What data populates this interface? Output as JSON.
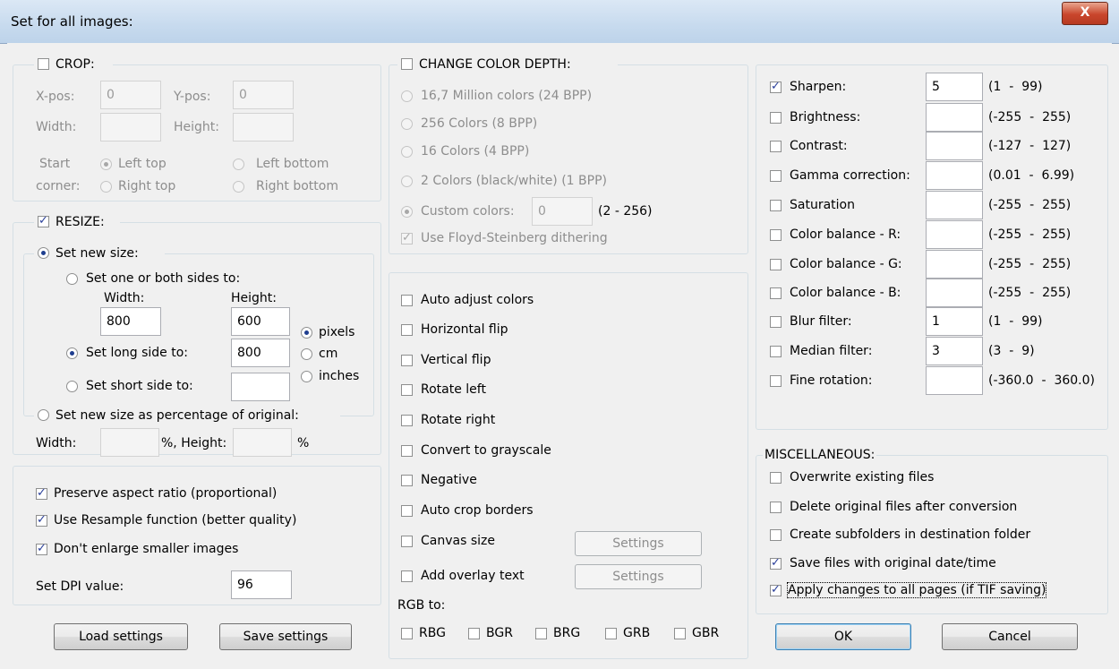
{
  "window": {
    "title": "Set for all images:",
    "close_label": "X"
  },
  "crop": {
    "label": "CROP:",
    "checked": false,
    "xpos_label": "X-pos:",
    "xpos_value": "0",
    "ypos_label": "Y-pos:",
    "ypos_value": "0",
    "width_label": "Width:",
    "width_value": "",
    "height_label": "Height:",
    "height_value": "",
    "start_label_1": "Start",
    "start_label_2": "corner:",
    "left_top": "Left top",
    "left_bottom": "Left bottom",
    "right_top": "Right top",
    "right_bottom": "Right bottom"
  },
  "resize": {
    "label": "RESIZE:",
    "checked": true,
    "set_new_size": "Set new size:",
    "one_or_both": "Set one or both sides to:",
    "width_label": "Width:",
    "height_label": "Height:",
    "width_value": "800",
    "height_value": "600",
    "long_side": "Set long side to:",
    "long_side_value": "800",
    "short_side": "Set short side to:",
    "short_side_value": "",
    "unit_pixels": "pixels",
    "unit_cm": "cm",
    "unit_inches": "inches",
    "percentage": "Set new size as percentage of original:",
    "pct_width_label": "Width:",
    "pct_width_value": "",
    "pct_height_label": "%, Height:",
    "pct_height_value": "",
    "pct_suffix": "%"
  },
  "options": {
    "preserve_aspect": "Preserve aspect ratio (proportional)",
    "use_resample": "Use Resample function (better quality)",
    "dont_enlarge": "Don't enlarge smaller images",
    "dpi_label": "Set DPI value:",
    "dpi_value": "96"
  },
  "buttons": {
    "load": "Load settings",
    "save": "Save settings",
    "ok": "OK",
    "cancel": "Cancel",
    "settings": "Settings"
  },
  "color_depth": {
    "label": "CHANGE COLOR DEPTH:",
    "checked": false,
    "opt_24": "16,7 Million colors (24 BPP)",
    "opt_8": "256 Colors (8 BPP)",
    "opt_4": "16 Colors (4 BPP)",
    "opt_1": "2 Colors (black/white) (1 BPP)",
    "custom": "Custom colors:",
    "custom_value": "0",
    "custom_range": "(2 - 256)",
    "dither": "Use Floyd-Steinberg dithering"
  },
  "transforms": {
    "auto_adjust": "Auto adjust colors",
    "hflip": "Horizontal flip",
    "vflip": "Vertical flip",
    "rot_left": "Rotate left",
    "rot_right": "Rotate right",
    "grayscale": "Convert to grayscale",
    "negative": "Negative",
    "autocrop": "Auto crop borders",
    "canvas": "Canvas size",
    "overlay": "Add overlay text",
    "rgb_label": "RGB to:",
    "rgb_options": [
      "RBG",
      "BGR",
      "BRG",
      "GRB",
      "GBR"
    ]
  },
  "adjust": [
    {
      "label": "Sharpen:",
      "checked": true,
      "value": "5",
      "range": "(1  -  99)"
    },
    {
      "label": "Brightness:",
      "checked": false,
      "value": "",
      "range": "(-255  -  255)"
    },
    {
      "label": "Contrast:",
      "checked": false,
      "value": "",
      "range": "(-127  -  127)"
    },
    {
      "label": "Gamma correction:",
      "checked": false,
      "value": "",
      "range": "(0.01  -  6.99)"
    },
    {
      "label": "Saturation",
      "checked": false,
      "value": "",
      "range": "(-255  -  255)"
    },
    {
      "label": "Color balance - R:",
      "checked": false,
      "value": "",
      "range": "(-255  -  255)"
    },
    {
      "label": "Color balance - G:",
      "checked": false,
      "value": "",
      "range": "(-255  -  255)"
    },
    {
      "label": "Color balance - B:",
      "checked": false,
      "value": "",
      "range": "(-255  -  255)"
    },
    {
      "label": "Blur filter:",
      "checked": false,
      "value": "1",
      "range": "(1  -  99)"
    },
    {
      "label": "Median filter:",
      "checked": false,
      "value": "3",
      "range": "(3  -  9)"
    },
    {
      "label": "Fine rotation:",
      "checked": false,
      "value": "",
      "range": "(-360.0  -  360.0)"
    }
  ],
  "misc": {
    "label": "MISCELLANEOUS:",
    "overwrite": "Overwrite existing files",
    "delete_orig": "Delete original files after conversion",
    "subfolders": "Create subfolders in destination folder",
    "keep_date": "Save files with original date/time",
    "all_pages": "Apply changes to all pages (if TIF saving)"
  }
}
